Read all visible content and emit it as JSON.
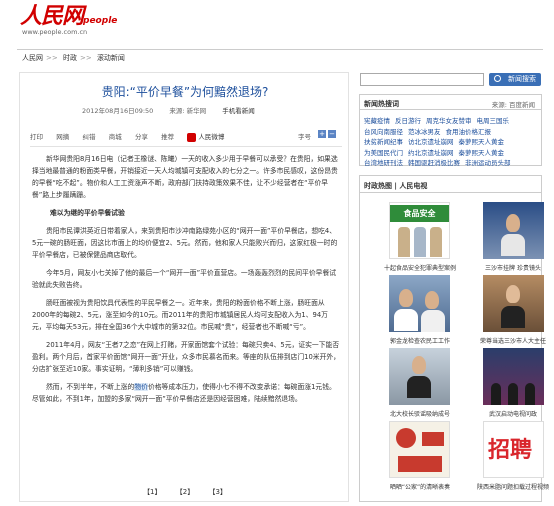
{
  "logo": {
    "cn": "人民网",
    "en": "people",
    "url": "www.people.com.cn"
  },
  "breadcrumb": [
    "人民网",
    "时政",
    "滚动新闻"
  ],
  "article": {
    "title": "贵阳:“平价早餐”为何黯然退场?",
    "date": "2012年08月16日09:50",
    "source": "来源: 新华网",
    "source2": "手机看新闻",
    "tools": [
      "打印",
      "网摘",
      "纠错",
      "商城",
      "分享",
      "推荐"
    ],
    "weibo": "人民微博",
    "fontsize": "字号",
    "p1": "新华网贵阳8月16日电（记者王橡谜、陈曦）一天的收入多少用于早餐可以承受？在贵阳，如果选择当地最普通的粉面类早餐，开销接近一天人均城镇可支配收入的七分之一。许多市民感叹，这份昂贵的早餐“吃不起”。物价和人工工资涨声不断，政府部门扶持政策效果不佳，让不少经营者在“平价早餐”路上步履蹒跚。",
    "sub1": "难以为继的平价早餐试验",
    "p2": "贵阳市民谭洪英近日带着家人，来到贵阳市沙冲南路绿苑小区的“网开一面”平价早餐店，想吃4、5元一碗的肠旺面，因这比市面上的均价便宜2、5元。然而，他和家人只能败兴而归，这家红极一时的平价早餐店，已被保健品商店取代。",
    "p3": "今年5月，网友小七关掉了他的最后一个“网开一面”平价直营店。一场轰轰烈烈的民间平价早餐试验就此失败告终。",
    "p4": "肠旺面被视为贵阳饮具代表性的平民早餐之一。近年来，贵阳的粉面价格不断上涨，肠旺面从2000年的每碗2、5元，涨至如今的10元。而2011年的贵阳市城镇居民人均可支配收入为1、94万元，平均每天53元，排在全国36个大中城市的第32位。市民喊“贵”，经营者也不断喊“亏”。",
    "p5": "2011年4月，网友“王者7之恋”在网上打赌，开家面馆套个试验：每碗只卖4、5元，证实一下能否盈利。两个月后，首家平价面馆“网开一面”开业，众多市民慕名而来。等座的队伍排到店门10米开外，分店扩张至近10家。事实证明，“薄利多销”可以赚钱。",
    "p6a": "然而，不到半年，不断上涨的",
    "p6hl": "物价",
    "p6b": "价格等成本压力，使得小七不得不改变承诺：每碗面涨1元钱。尽管如此，不到1年，加盟的多家“网开一面”平价早餐店还是因经营困难，陆续黯然退场。",
    "pages": [
      "【1】",
      "【2】",
      "【3】"
    ]
  },
  "search": {
    "placeholder": "",
    "button": "新闻搜索"
  },
  "hot": {
    "title": "新闻热搜词",
    "source": "来源: 百度新闻",
    "rows": [
      [
        "宪藏疫情",
        "反日游行",
        "周克华女友赞审",
        "电周三国乐"
      ],
      [
        "台风向南服径",
        "范冰冰男友",
        "食用油价格汇报"
      ],
      [
        "扶贫新闻纪事",
        "访北京遗址崩网",
        "秦萝熙天人黄金"
      ],
      [
        "为美国民代门",
        "约北京遗址崩网",
        "秦萝熙天人黄金"
      ],
      [
        "台湾地研刊法",
        "韩国驱赶消极比赛",
        "非洲运动员头部"
      ]
    ]
  },
  "video": {
    "title": "时政热图 | 人民电视",
    "items": [
      {
        "cap": "十起食品安全犯罪典型案例",
        "banner": "食品安全"
      },
      {
        "cap": "三沙市挂牌 珍贵镜头"
      },
      {
        "cap": "郭金龙检查农民工工作"
      },
      {
        "cap": "荣尊当选三沙市人大主任"
      },
      {
        "cap": "北大校长驳谣吸纳成号"
      },
      {
        "cap": "武汉启动电视问政"
      },
      {
        "cap": "晒晒“公家”的清晰表奏"
      },
      {
        "cap": "陕西米脂问题扣载过程视频",
        "banner": "招聘"
      }
    ]
  }
}
